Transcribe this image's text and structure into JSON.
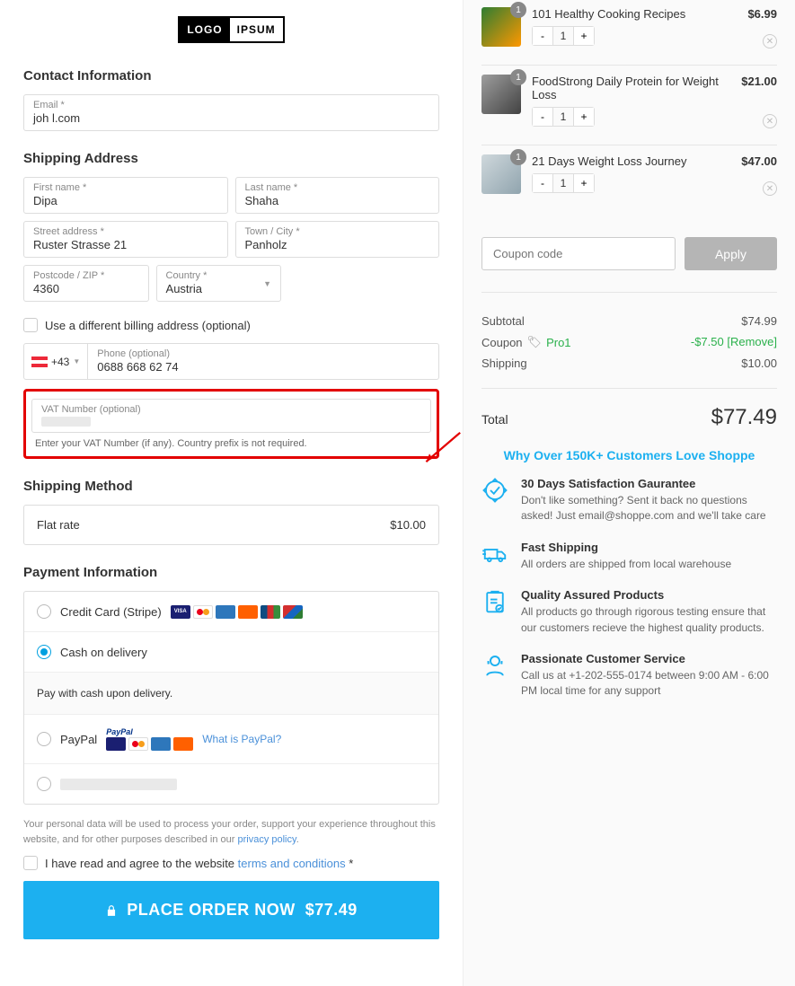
{
  "logo": {
    "left": "LOGO",
    "right": "IPSUM"
  },
  "contact": {
    "heading": "Contact Information",
    "email_label": "Email *",
    "email_value": "joh                  l.com"
  },
  "shipping": {
    "heading": "Shipping Address",
    "first_name_label": "First name *",
    "first_name": "Dipa",
    "last_name_label": "Last name *",
    "last_name": "Shaha",
    "street_label": "Street address *",
    "street": "Ruster Strasse 21",
    "city_label": "Town / City *",
    "city": "Panholz",
    "postcode_label": "Postcode / ZIP *",
    "postcode": "4360",
    "country_label": "Country *",
    "country": "Austria",
    "diff_billing": "Use a different billing address (optional)",
    "phone_code": "+43",
    "phone_label": "Phone (optional)",
    "phone": "0688 668 62 74",
    "vat_label": "VAT Number (optional)",
    "vat_help": "Enter your VAT Number (if any). Country prefix is not required."
  },
  "shipping_method": {
    "heading": "Shipping Method",
    "flat_rate": "Flat rate",
    "flat_price": "$10.00"
  },
  "payment": {
    "heading": "Payment Information",
    "credit_card": "Credit Card (Stripe)",
    "cod": "Cash on delivery",
    "cod_desc": "Pay with cash upon delivery.",
    "paypal": "PayPal",
    "paypal_link": "What is PayPal?",
    "legal": "Your personal data will be used to process your order, support your experience throughout this website, and for other purposes described in our ",
    "privacy": "privacy policy",
    "terms_pre": "I have read and agree to the website ",
    "terms": "terms and conditions",
    "terms_suf": " *",
    "button_text": "PLACE ORDER NOW",
    "button_total": "$77.49"
  },
  "cart": {
    "items": [
      {
        "name": "101 Healthy Cooking Recipes",
        "price": "$6.99",
        "qty": "1"
      },
      {
        "name": "FoodStrong Daily Protein for Weight Loss",
        "price": "$21.00",
        "qty": "1"
      },
      {
        "name": "21 Days Weight Loss Journey",
        "price": "$47.00",
        "qty": "1"
      }
    ],
    "coupon_placeholder": "Coupon code",
    "apply": "Apply",
    "subtotal_label": "Subtotal",
    "subtotal": "$74.99",
    "coupon_label": "Coupon",
    "coupon_code": "Pro1",
    "coupon_value": "-$7.50",
    "remove": "[Remove]",
    "shipping_label": "Shipping",
    "shipping": "$10.00",
    "total_label": "Total",
    "total": "$77.49"
  },
  "why": {
    "heading": "Why Over 150K+ Customers Love Shoppe",
    "features": [
      {
        "title": "30 Days Satisfaction Gaurantee",
        "desc": "Don't like something? Sent it back no questions asked! Just email@shoppe.com and we'll take care"
      },
      {
        "title": "Fast Shipping",
        "desc": "All orders are shipped from local warehouse"
      },
      {
        "title": "Quality Assured Products",
        "desc": "All products go through rigorous testing ensure that our customers recieve the highest quality products."
      },
      {
        "title": "Passionate Customer Service",
        "desc": "Call us at +1-202-555-0174 between 9:00 AM - 6:00 PM local time for any support"
      }
    ]
  }
}
